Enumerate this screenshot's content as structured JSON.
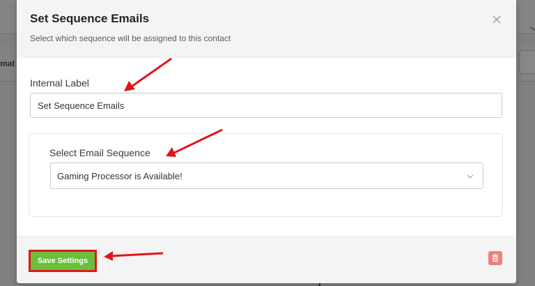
{
  "background": {
    "fragment_text": "mat"
  },
  "modal": {
    "title": "Set Sequence Emails",
    "subtitle": "Select which sequence will be assigned to this contact",
    "close_icon": "close-icon"
  },
  "form": {
    "internal_label": {
      "label": "Internal Label",
      "value": "Set Sequence Emails"
    },
    "email_sequence": {
      "label": "Select Email Sequence",
      "selected": "Gaming Processor is Available!"
    }
  },
  "footer": {
    "save_label": "Save Settings",
    "delete_icon": "trash-icon"
  },
  "colors": {
    "save_button": "#6abf3a",
    "highlight": "#e3151a",
    "delete_button": "#ee7f7f"
  }
}
